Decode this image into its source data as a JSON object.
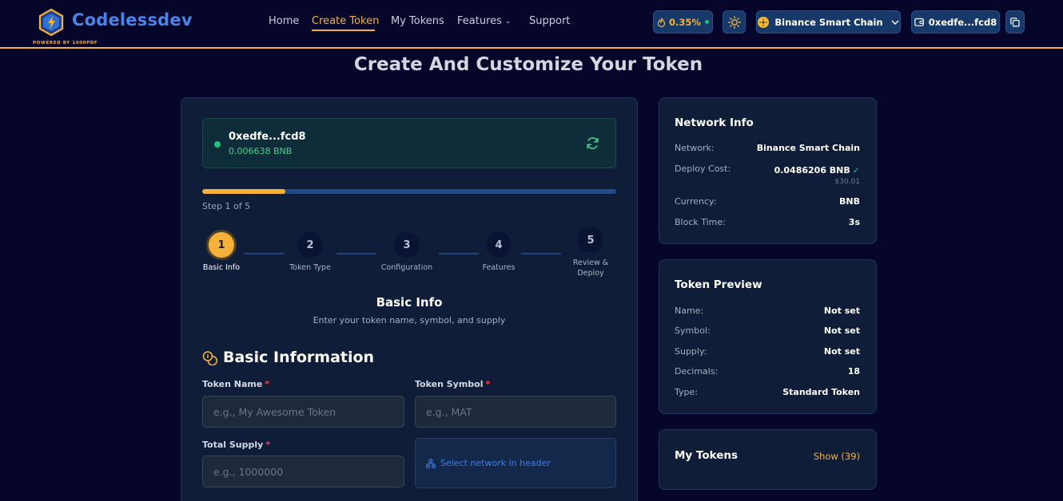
{
  "brand": {
    "name": "Codelessdev",
    "powered_by": "POWERED BY 1000PDF"
  },
  "nav": {
    "items": [
      {
        "label": "Home"
      },
      {
        "label": "Create Token"
      },
      {
        "label": "My Tokens"
      },
      {
        "label": "Features"
      },
      {
        "label": "Support"
      }
    ],
    "active": "Create Token"
  },
  "header": {
    "gas_value": "0.35%",
    "network": "Binance Smart Chain",
    "wallet": "0xedfe...fcd8"
  },
  "page_title": "Create And Customize Your Token",
  "wallet_box": {
    "address": "0xedfe...fcd8",
    "balance": "0.006638 BNB"
  },
  "progress": {
    "fraction": 0.2,
    "text": "Step 1 of 5"
  },
  "steps": [
    {
      "number": "1",
      "label": "Basic Info",
      "active": true
    },
    {
      "number": "2",
      "label": "Token Type"
    },
    {
      "number": "3",
      "label": "Configuration"
    },
    {
      "number": "4",
      "label": "Features"
    },
    {
      "number": "5",
      "label": "Review &\nDeploy"
    }
  ],
  "section": {
    "title": "Basic Info",
    "subtitle": "Enter your token name, symbol, and supply"
  },
  "form": {
    "heading": "Basic Information",
    "token_name": {
      "label": "Token Name",
      "required": "*",
      "placeholder": "e.g., My Awesome Token",
      "value": ""
    },
    "token_symbol": {
      "label": "Token Symbol",
      "required": "*",
      "placeholder": "e.g., MAT",
      "value": ""
    },
    "total_supply": {
      "label": "Total Supply",
      "required": "*",
      "placeholder": "e.g., 1000000",
      "value": ""
    },
    "network_hint": "Select network in header"
  },
  "network_info": {
    "title": "Network Info",
    "rows": [
      {
        "label": "Network:",
        "value": "Binance Smart Chain"
      },
      {
        "label": "Deploy Cost:",
        "value": "0.0486206 BNB",
        "check": "✓",
        "sub": "$30.01"
      },
      {
        "label": "Currency:",
        "value": "BNB"
      },
      {
        "label": "Block Time:",
        "value": "3s"
      }
    ]
  },
  "token_preview": {
    "title": "Token Preview",
    "rows": [
      {
        "label": "Name:",
        "value": "Not set"
      },
      {
        "label": "Symbol:",
        "value": "Not set"
      },
      {
        "label": "Supply:",
        "value": "Not set"
      },
      {
        "label": "Decimals:",
        "value": "18"
      },
      {
        "label": "Type:",
        "value": "Standard Token"
      }
    ]
  },
  "my_tokens": {
    "title": "My Tokens",
    "show_label": "Show (39)"
  },
  "colors": {
    "accent": "#f5b13a",
    "brand_blue": "#4c83e8",
    "success": "#22c17a",
    "background": "#05062a"
  },
  "icons": [
    "logo-icon",
    "gas-icon",
    "sun-icon",
    "bnb-icon",
    "chevron-down-icon",
    "wallet-icon",
    "copy-icon",
    "refresh-icon",
    "coins-icon",
    "network-icon"
  ]
}
